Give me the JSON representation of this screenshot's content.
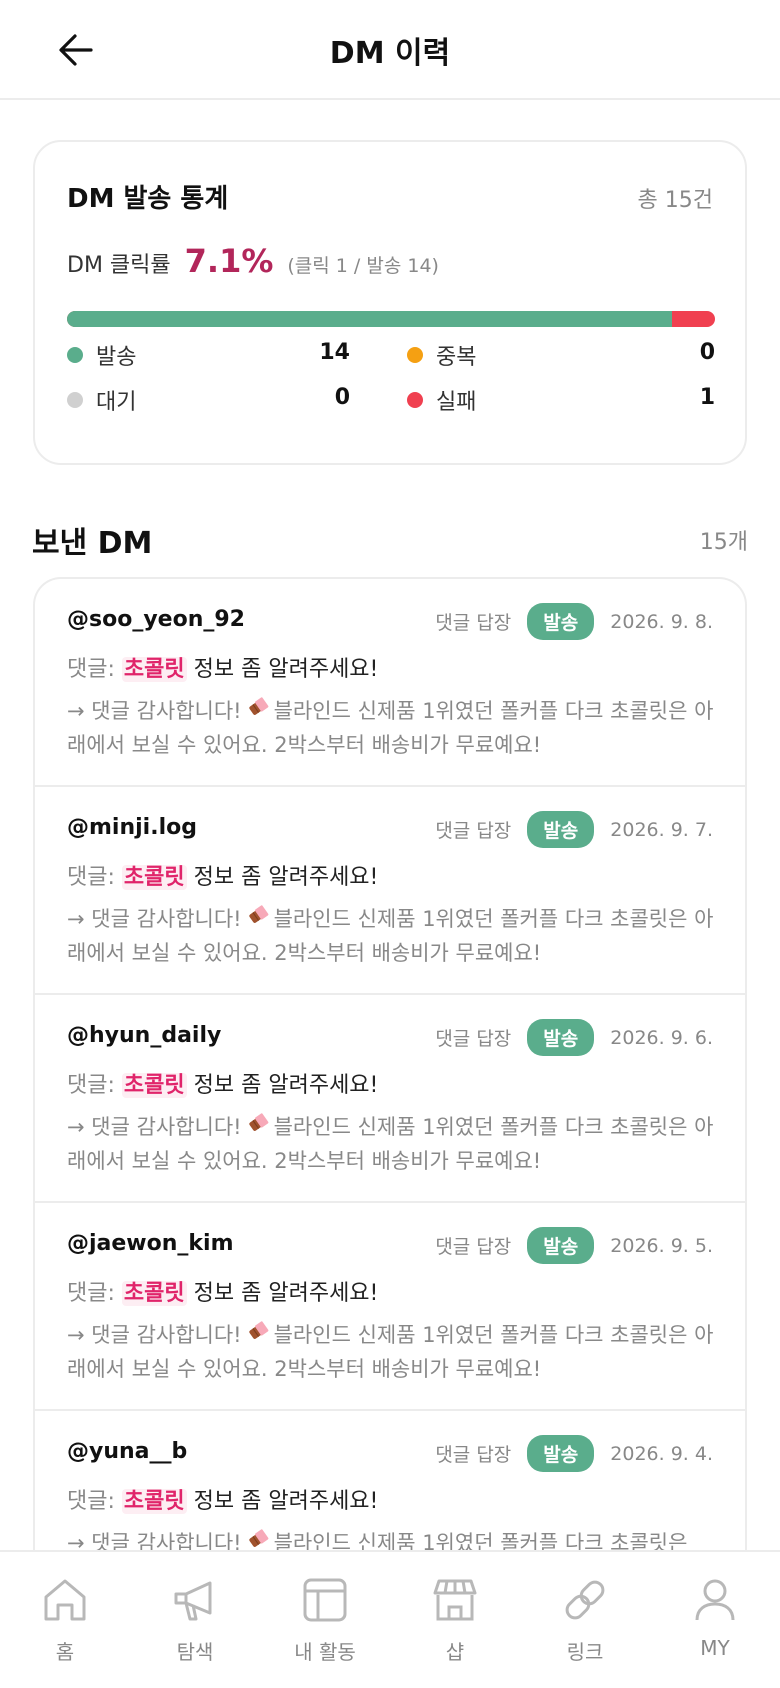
{
  "header": {
    "title": "DM 이력"
  },
  "stats": {
    "title": "DM 발송 통계",
    "total": "총 15건",
    "rate_label": "DM 클릭률",
    "rate_value": "7.1%",
    "rate_detail": "(클릭 1 / 발송 14)",
    "progress": {
      "sent_fraction": 0.933,
      "failed_fraction": 0.067
    },
    "legend": {
      "sent": {
        "label": "발송",
        "value": "14",
        "color": "#5aad8c"
      },
      "duplicate": {
        "label": "중복",
        "value": "0",
        "color": "#f5a012"
      },
      "waiting": {
        "label": "대기",
        "value": "0",
        "color": "#d0d0d0"
      },
      "failed": {
        "label": "실패",
        "value": "1",
        "color": "#f04050"
      }
    }
  },
  "section": {
    "title": "보낸 DM",
    "count": "15개"
  },
  "dms": [
    {
      "user": "@soo_yeon_92",
      "type": "댓글 답장",
      "status": "발송",
      "date": "2026. 9. 8.",
      "comment_prefix": "댓글:",
      "comment_keyword": "초콜릿",
      "comment_rest": "정보 좀 알려주세요!",
      "reply_start": "→ 댓글 감사합니다!",
      "reply_end": "블라인드 신제품 1위였던 폴커플 다크 초콜릿은 아래에서 보실 수 있어요. 2박스부터 배송비가 무료예요!"
    },
    {
      "user": "@minji.log",
      "type": "댓글 답장",
      "status": "발송",
      "date": "2026. 9. 7.",
      "comment_prefix": "댓글:",
      "comment_keyword": "초콜릿",
      "comment_rest": "정보 좀 알려주세요!",
      "reply_start": "→ 댓글 감사합니다!",
      "reply_end": "블라인드 신제품 1위였던 폴커플 다크 초콜릿은 아래에서 보실 수 있어요. 2박스부터 배송비가 무료예요!"
    },
    {
      "user": "@hyun_daily",
      "type": "댓글 답장",
      "status": "발송",
      "date": "2026. 9. 6.",
      "comment_prefix": "댓글:",
      "comment_keyword": "초콜릿",
      "comment_rest": "정보 좀 알려주세요!",
      "reply_start": "→ 댓글 감사합니다!",
      "reply_end": "블라인드 신제품 1위였던 폴커플 다크 초콜릿은 아래에서 보실 수 있어요. 2박스부터 배송비가 무료예요!"
    },
    {
      "user": "@jaewon_kim",
      "type": "댓글 답장",
      "status": "발송",
      "date": "2026. 9. 5.",
      "comment_prefix": "댓글:",
      "comment_keyword": "초콜릿",
      "comment_rest": "정보 좀 알려주세요!",
      "reply_start": "→ 댓글 감사합니다!",
      "reply_end": "블라인드 신제품 1위였던 폴커플 다크 초콜릿은 아래에서 보실 수 있어요. 2박스부터 배송비가 무료예요!"
    },
    {
      "user": "@yuna__b",
      "type": "댓글 답장",
      "status": "발송",
      "date": "2026. 9. 4.",
      "comment_prefix": "댓글:",
      "comment_keyword": "초콜릿",
      "comment_rest": "정보 좀 알려주세요!",
      "reply_start": "→ 댓글 감사합니다!",
      "reply_end": "블라인드 신제품 1위였던 폴커플 다크 초콜릿은"
    }
  ],
  "nav": [
    {
      "label": "홈",
      "icon": "home-icon"
    },
    {
      "label": "탐색",
      "icon": "megaphone-icon"
    },
    {
      "label": "내 활동",
      "icon": "layout-icon"
    },
    {
      "label": "샵",
      "icon": "store-icon"
    },
    {
      "label": "링크",
      "icon": "link-icon"
    },
    {
      "label": "MY",
      "icon": "user-icon"
    }
  ],
  "colors": {
    "accent": "#5aad8c",
    "rate": "#b2265a",
    "keyword": "#e0246a",
    "failed": "#f04050",
    "duplicate": "#f5a012",
    "waiting": "#d0d0d0"
  }
}
